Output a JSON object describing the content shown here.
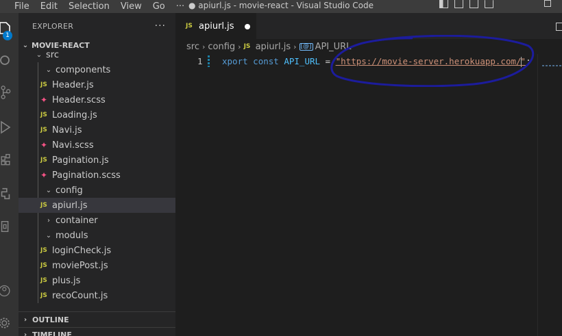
{
  "menu": [
    "File",
    "Edit",
    "Selection",
    "View",
    "Go",
    "···"
  ],
  "window_title": "● apiurl.js - movie-react - Visual Studio Code",
  "activity": {
    "badge": "1"
  },
  "explorer": {
    "header": "EXPLORER",
    "more": "···",
    "project": "MOVIE-REACT",
    "tree": [
      {
        "label": "src",
        "type": "folder",
        "open": true,
        "depth": 1
      },
      {
        "label": "components",
        "type": "folder",
        "open": true,
        "depth": 2
      },
      {
        "label": "Header.js",
        "type": "js",
        "depth": 3
      },
      {
        "label": "Header.scss",
        "type": "scss",
        "depth": 3
      },
      {
        "label": "Loading.js",
        "type": "js",
        "depth": 3
      },
      {
        "label": "Navi.js",
        "type": "js",
        "depth": 3
      },
      {
        "label": "Navi.scss",
        "type": "scss",
        "depth": 3
      },
      {
        "label": "Pagination.js",
        "type": "js",
        "depth": 3
      },
      {
        "label": "Pagination.scss",
        "type": "scss",
        "depth": 3
      },
      {
        "label": "config",
        "type": "folder",
        "open": true,
        "depth": 2
      },
      {
        "label": "apiurl.js",
        "type": "js",
        "depth": 3,
        "selected": true
      },
      {
        "label": "container",
        "type": "folder",
        "open": false,
        "depth": 2
      },
      {
        "label": "moduls",
        "type": "folder",
        "open": true,
        "depth": 2
      },
      {
        "label": "loginCheck.js",
        "type": "js",
        "depth": 3
      },
      {
        "label": "moviePost.js",
        "type": "js",
        "depth": 3
      },
      {
        "label": "plus.js",
        "type": "js",
        "depth": 3
      },
      {
        "label": "recoCount.js",
        "type": "js",
        "depth": 3
      }
    ],
    "outline": "OUTLINE",
    "timeline": "TIMELINE"
  },
  "editor": {
    "tab": {
      "icon": "JS",
      "name": "apiurl.js"
    },
    "breadcrumb": [
      "src",
      "config",
      "apiurl.js",
      "API_URL"
    ],
    "code": {
      "line_number": "1",
      "keyword_export": "xport",
      "keyword_const": "const",
      "identifier": "API_URL",
      "operator": " = ",
      "string_open": "\"",
      "string_url": "https://movie-server.herokuapp.com/",
      "string_close": "\"",
      "terminator": ";"
    }
  },
  "colors": {
    "annotation": "#1c1c9c",
    "js_icon": "#cbcb41",
    "scss_icon": "#f55385",
    "badge": "#007acc"
  }
}
